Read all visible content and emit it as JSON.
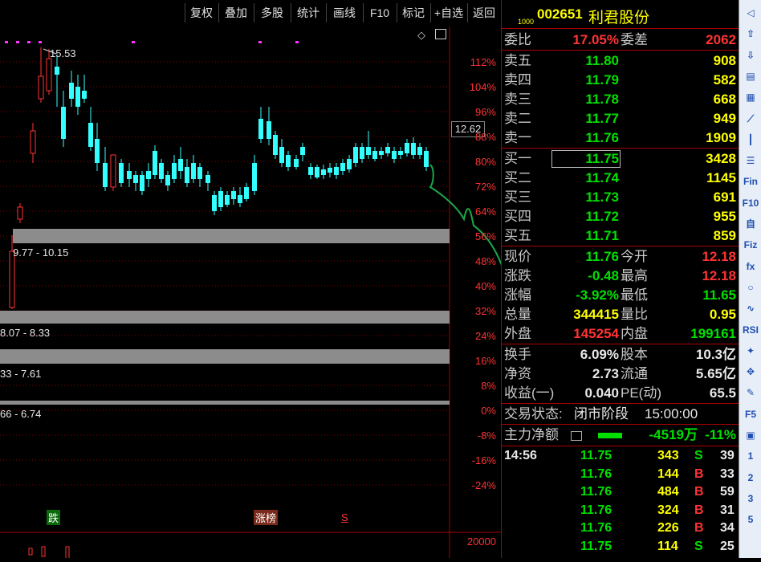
{
  "toolbar": [
    "复权",
    "叠加",
    "多股",
    "统计",
    "画线",
    "F10",
    "标记",
    "+自选",
    "返回"
  ],
  "chart": {
    "peak_label": "15.53",
    "current_price_tag": "12.62",
    "pct_ticks": [
      "112%",
      "104%",
      "96%",
      "88%",
      "80%",
      "72%",
      "64%",
      "56%",
      "48%",
      "40%",
      "32%",
      "24%",
      "16%",
      "8%",
      "0%",
      "-8%",
      "-16%",
      "-24%"
    ],
    "zones": [
      "9.77 - 10.15",
      "8.07 - 8.33",
      "33 - 7.61",
      "66 - 6.74"
    ],
    "bottom_labels": {
      "down": "跌",
      "limit_list": "涨榜",
      "s_mark": "S"
    },
    "volume_tick": "20000"
  },
  "stock": {
    "small_tag": "1000",
    "code": "002651",
    "name": "利君股份"
  },
  "weibi": {
    "label": "委比",
    "value": "17.05%",
    "label2": "委差",
    "value2": "2062"
  },
  "asks": [
    {
      "label": "卖五",
      "price": "11.80",
      "vol": "908"
    },
    {
      "label": "卖四",
      "price": "11.79",
      "vol": "582"
    },
    {
      "label": "卖三",
      "price": "11.78",
      "vol": "668"
    },
    {
      "label": "卖二",
      "price": "11.77",
      "vol": "949"
    },
    {
      "label": "卖一",
      "price": "11.76",
      "vol": "1909"
    }
  ],
  "bids": [
    {
      "label": "买一",
      "price": "11.75",
      "vol": "3428"
    },
    {
      "label": "买二",
      "price": "11.74",
      "vol": "1145"
    },
    {
      "label": "买三",
      "price": "11.73",
      "vol": "691"
    },
    {
      "label": "买四",
      "price": "11.72",
      "vol": "955"
    },
    {
      "label": "买五",
      "price": "11.71",
      "vol": "859"
    }
  ],
  "quote": [
    {
      "l1": "现价",
      "v1": "11.76",
      "l2": "今开",
      "v2": "12.18"
    },
    {
      "l1": "涨跌",
      "v1": "-0.48",
      "l2": "最高",
      "v2": "12.18"
    },
    {
      "l1": "涨幅",
      "v1": "-3.92%",
      "l2": "最低",
      "v2": "11.65"
    },
    {
      "l1": "总量",
      "v1": "344415",
      "l2": "量比",
      "v2": "0.95"
    },
    {
      "l1": "外盘",
      "v1": "145254",
      "l2": "内盘",
      "v2": "199161"
    }
  ],
  "fund": [
    {
      "l1": "换手",
      "v1": "6.09%",
      "l2": "股本",
      "v2": "10.3亿"
    },
    {
      "l1": "净资",
      "v1": "2.73",
      "l2": "流通",
      "v2": "5.65亿"
    },
    {
      "l1": "收益(一)",
      "v1": "0.040",
      "l2": "PE(动)",
      "v2": "65.5"
    }
  ],
  "status": {
    "label": "交易状态:",
    "value": "闭市阶段",
    "time": "15:00:00"
  },
  "main_flow": {
    "label": "主力净额",
    "value": "-4519万",
    "pct": "-11%"
  },
  "ticks": [
    {
      "time": "14:56",
      "price": "11.75",
      "vol": "343",
      "side": "S",
      "n": "39"
    },
    {
      "time": "",
      "price": "11.76",
      "vol": "144",
      "side": "B",
      "n": "33"
    },
    {
      "time": "",
      "price": "11.76",
      "vol": "484",
      "side": "B",
      "n": "59"
    },
    {
      "time": "",
      "price": "11.76",
      "vol": "324",
      "side": "B",
      "n": "31"
    },
    {
      "time": "",
      "price": "11.76",
      "vol": "226",
      "side": "B",
      "n": "34"
    },
    {
      "time": "",
      "price": "11.75",
      "vol": "114",
      "side": "S",
      "n": "25"
    }
  ],
  "side_icons": [
    "◁",
    "⇧",
    "⇩",
    "books-icon",
    "grid-icon",
    "line-icon",
    "candle-icon",
    "list-icon",
    "Fin",
    "F10",
    "自",
    "Fiz",
    "fx",
    "circle-icon",
    "wave-icon",
    "RSI",
    "compass-icon",
    "move-icon",
    "pen-icon",
    "F5",
    "plate-icon",
    "1",
    "2",
    "3",
    "5"
  ],
  "colors": {
    "up": "#ff3333",
    "down": "#00e000",
    "cyan": "#33ffff",
    "volume": "#ffff00"
  }
}
